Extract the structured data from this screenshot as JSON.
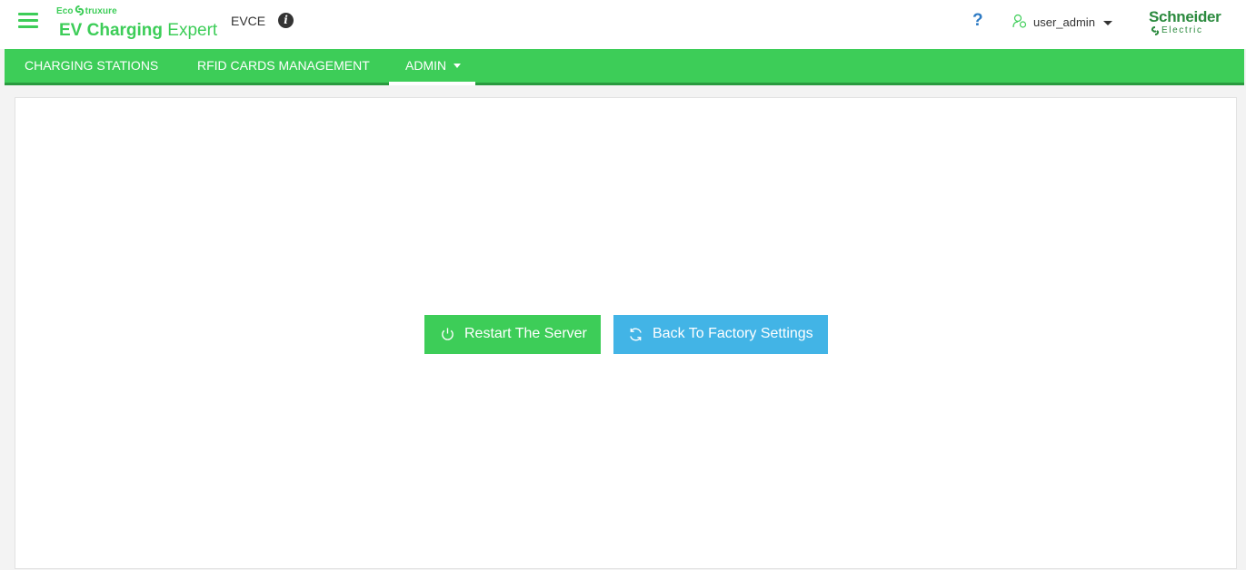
{
  "header": {
    "brand_top_left": "Eco",
    "brand_top_right": "truxure",
    "brand_main_bold": "EV Charging",
    "brand_main_light": " Expert",
    "site_name": "EVCE",
    "help_label": "?",
    "user_name": "user_admin",
    "logo_word": "Schneider",
    "logo_sub": "Electric"
  },
  "nav": {
    "items": [
      {
        "label": "CHARGING STATIONS"
      },
      {
        "label": "RFID CARDS MANAGEMENT"
      },
      {
        "label": "ADMIN",
        "active": true
      }
    ]
  },
  "main": {
    "restart_label": "Restart The Server",
    "factory_label": "Back To Factory Settings"
  },
  "colors": {
    "accent_green": "#3dcd58",
    "nav_border": "#2a9a3f",
    "factory_blue": "#42b4e6",
    "help_blue": "#2e7bc4",
    "logo_green": "#2b8a3e"
  },
  "icons": {
    "menu": "hamburger-menu-icon",
    "info": "info-icon",
    "help": "help-icon",
    "user": "user-icon",
    "restart": "power-icon",
    "factory": "refresh-icon"
  }
}
